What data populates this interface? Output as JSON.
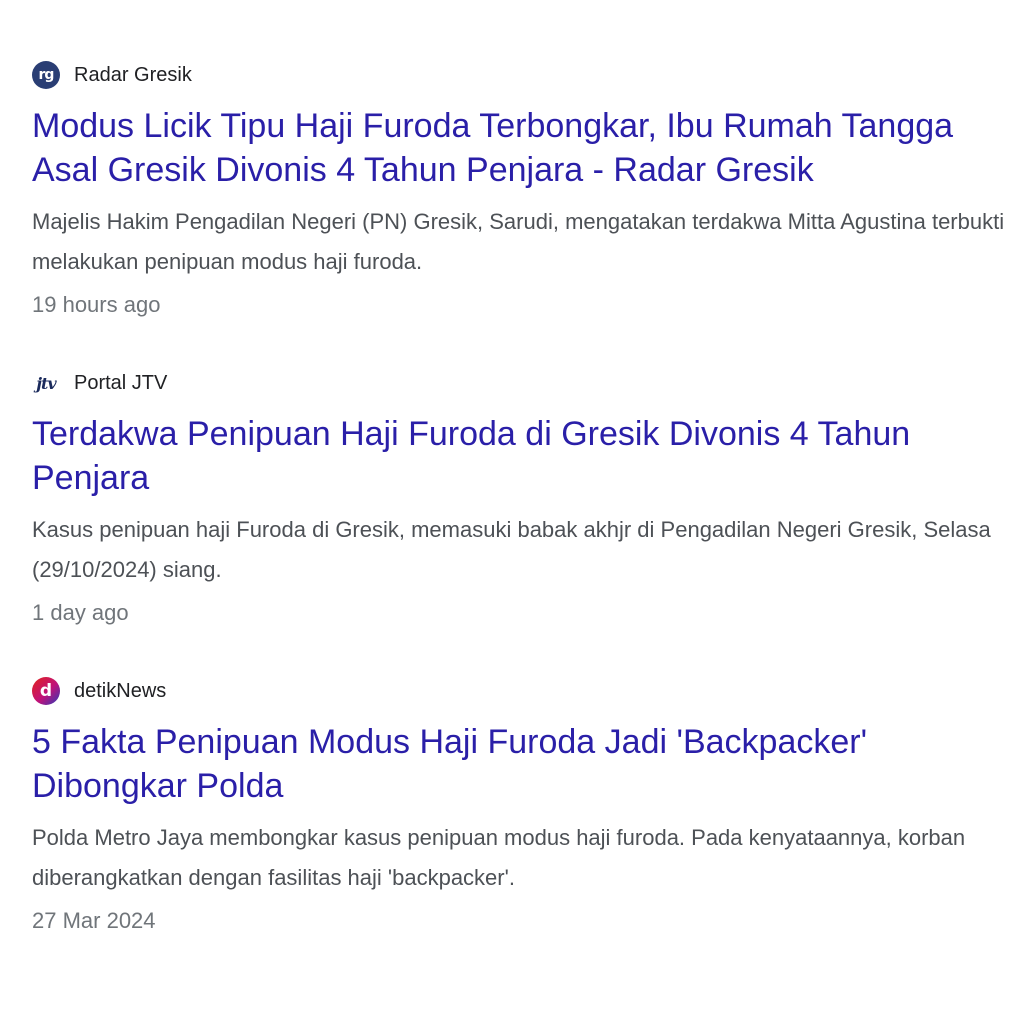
{
  "results": [
    {
      "source": "Radar Gresik",
      "icon": "radar-gresik-logo-icon",
      "icon_text": "rg",
      "title": "Modus Licik Tipu Haji Furoda Terbongkar, Ibu Rumah Tangga Asal Gresik Divonis 4 Tahun Penjara - Radar Gresik",
      "snippet": "Majelis Hakim Pengadilan Negeri (PN) Gresik, Sarudi, mengatakan terdakwa Mitta Agustina terbukti melakukan penipuan modus haji furoda.",
      "time": "19 hours ago"
    },
    {
      "source": "Portal JTV",
      "icon": "portal-jtv-logo-icon",
      "icon_text": "jtv",
      "title": "Terdakwa Penipuan Haji Furoda di Gresik Divonis 4 Tahun Penjara",
      "snippet": "Kasus penipuan haji Furoda di Gresik, memasuki babak akhjr di Pengadilan Negeri Gresik, Selasa (29/10/2024) siang.",
      "time": "1 day ago"
    },
    {
      "source": "detikNews",
      "icon": "detiknews-logo-icon",
      "icon_text": "d",
      "title": "5 Fakta Penipuan Modus Haji Furoda Jadi 'Backpacker' Dibongkar Polda",
      "snippet": "Polda Metro Jaya membongkar kasus penipuan modus haji furoda. Pada kenyataannya, korban diberangkatkan dengan fasilitas haji 'backpacker'.",
      "time": "27 Mar 2024"
    }
  ]
}
